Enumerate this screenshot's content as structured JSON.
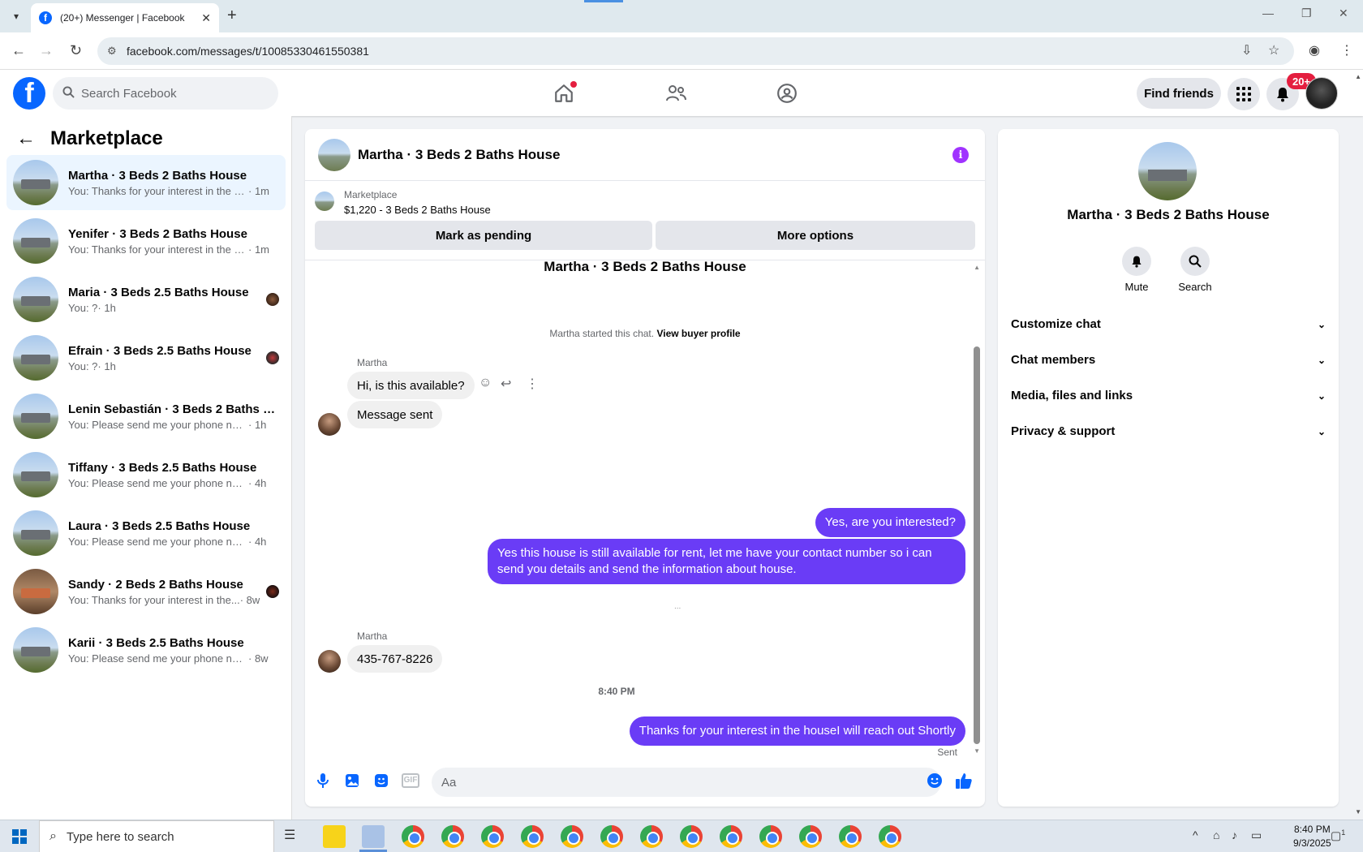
{
  "browser": {
    "tab_title": "(20+) Messenger | Facebook",
    "url": "facebook.com/messages/t/10085330461550381"
  },
  "fb_header": {
    "search_placeholder": "Search Facebook",
    "find_friends": "Find friends",
    "notif_badge": "20+",
    "logo_letter": "f"
  },
  "left": {
    "title": "Marketplace",
    "conversations": [
      {
        "name": "Martha · 3 Beds 2 Baths House",
        "preview": "You: Thanks for your interest in the h...",
        "time": "· 1m",
        "active": true
      },
      {
        "name": "Yenifer · 3 Beds 2 Baths House",
        "preview": "You: Thanks for your interest in the h...",
        "time": "· 1m"
      },
      {
        "name": "Maria · 3 Beds 2.5 Baths House",
        "preview": "You: ?",
        "time": "· 1h"
      },
      {
        "name": "Efrain · 3 Beds 2.5 Baths House",
        "preview": "You: ?",
        "time": "· 1h"
      },
      {
        "name": "Lenin Sebastián · 3 Beds 2 Baths H...",
        "preview": "You: Please send me your phone num...",
        "time": "· 1h"
      },
      {
        "name": "Tiffany · 3 Beds 2.5 Baths House",
        "preview": "You: Please send me your phone num...",
        "time": "· 4h"
      },
      {
        "name": "Laura · 3 Beds 2.5 Baths House",
        "preview": "You: Please send me your phone num...",
        "time": "· 4h"
      },
      {
        "name": "Sandy · 2 Beds 2 Baths House",
        "preview": "You: Thanks for your interest in the...",
        "time": "· 8w"
      },
      {
        "name": "Karii · 3 Beds 2.5 Baths House",
        "preview": "You: Please send me your phone num...",
        "time": "· 8w"
      }
    ]
  },
  "chat": {
    "title": "Martha · 3 Beds 2 Baths House",
    "info_glyph": "i",
    "marketplace_label": "Marketplace",
    "listing": "$1,220 - 3 Beds 2 Baths House",
    "mark_pending": "Mark as pending",
    "more_options": "More options",
    "thread_title": "Martha · 3 Beds 2 Baths House",
    "started_text": "Martha started this chat.",
    "view_buyer": "View buyer profile",
    "sender_name": "Martha",
    "messages": {
      "in1": "Hi, is this available?",
      "in2": "Message sent",
      "out1": "Yes, are you interested?",
      "out2": "Yes this house is still available for rent, let me have your contact number so i can send you details and send the information about house.",
      "in3": "435-767-8226",
      "out3": "Thanks for your interest in the houseI will reach out Shortly"
    },
    "typing": "...",
    "timestamp": "8:40 PM",
    "sent_label": "Sent",
    "composer_placeholder": "Aa",
    "gif_label": "GIF"
  },
  "right": {
    "title": "Martha · 3 Beds 2 Baths House",
    "mute": "Mute",
    "search": "Search",
    "rows": [
      "Customize chat",
      "Chat members",
      "Media, files and links",
      "Privacy & support"
    ]
  },
  "taskbar": {
    "search_placeholder": "Type here to search",
    "time": "8:40 PM",
    "date": "9/3/2025",
    "notif_count": "1"
  }
}
